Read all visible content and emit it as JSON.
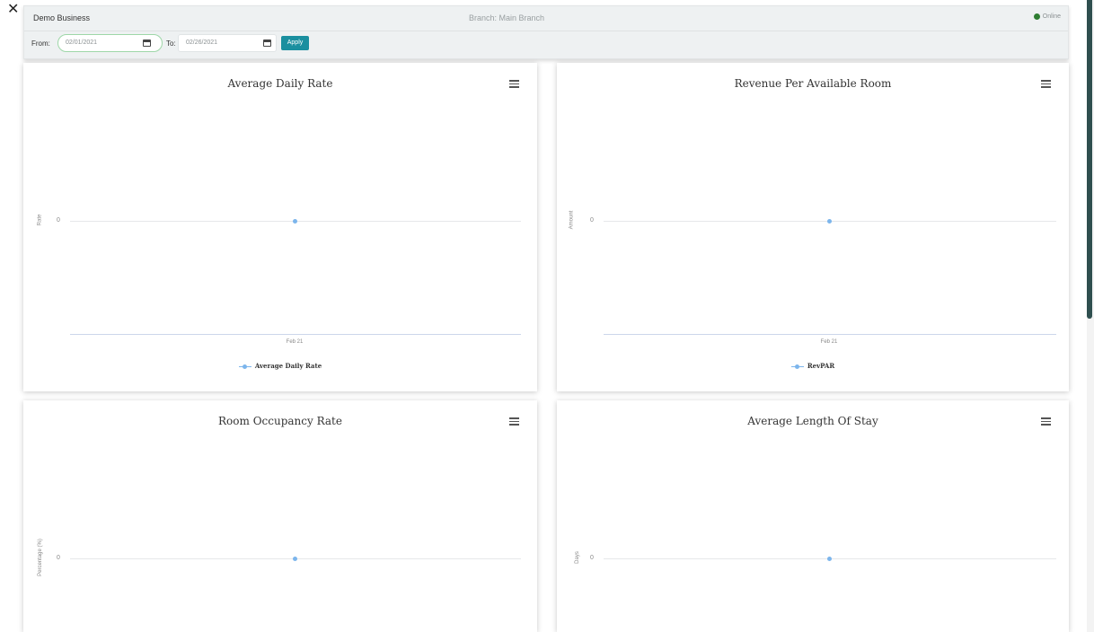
{
  "window": {
    "close_glyph": "✕"
  },
  "header": {
    "business_name": "Demo Business",
    "branch_text": "Branch: Main Branch",
    "status_text": "Online",
    "status_color": "#2e7d32"
  },
  "filters": {
    "from_label": "From:",
    "from_value": "02/01/2021",
    "to_label": "To:",
    "to_value": "02/26/2021",
    "apply_label": "Apply",
    "accent_color": "#1a8f9f"
  },
  "cards": [
    {
      "title": "Average Daily Rate",
      "y_label": "Rate",
      "y_tick": "0",
      "x_tick": "Feb 21",
      "legend": "Average Daily Rate",
      "menu_icon": "hamburger-icon"
    },
    {
      "title": "Revenue Per Available Room",
      "y_label": "Amount",
      "y_tick": "0",
      "x_tick": "Feb 21",
      "legend": "RevPAR",
      "menu_icon": "hamburger-icon"
    },
    {
      "title": "Room Occupancy Rate",
      "y_label": "Percentage (%)",
      "y_tick": "0",
      "menu_icon": "hamburger-icon"
    },
    {
      "title": "Average Length Of Stay",
      "y_label": "Days",
      "y_tick": "0",
      "menu_icon": "hamburger-icon"
    }
  ],
  "chart_data": [
    {
      "type": "line",
      "title": "Average Daily Rate",
      "ylabel": "Rate",
      "categories": [
        "Feb 21"
      ],
      "series": [
        {
          "name": "Average Daily Rate",
          "values": [
            0
          ]
        }
      ]
    },
    {
      "type": "line",
      "title": "Revenue Per Available Room",
      "ylabel": "Amount",
      "categories": [
        "Feb 21"
      ],
      "series": [
        {
          "name": "RevPAR",
          "values": [
            0
          ]
        }
      ]
    },
    {
      "type": "line",
      "title": "Room Occupancy Rate",
      "ylabel": "Percentage (%)",
      "series": [
        {
          "values": [
            0
          ]
        }
      ]
    },
    {
      "type": "line",
      "title": "Average Length Of Stay",
      "ylabel": "Days",
      "series": [
        {
          "values": [
            0
          ]
        }
      ]
    }
  ],
  "colors": {
    "series": "#7cb5ec",
    "scrollbar": "#2f4f4f"
  }
}
